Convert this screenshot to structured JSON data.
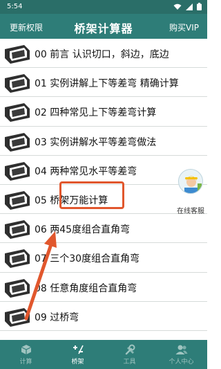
{
  "status_bar": {
    "time": "5:54",
    "icons": [
      "wifi-icon",
      "signal-icon",
      "battery-icon"
    ]
  },
  "app_bar": {
    "left_label": "更新权限",
    "title": "桥架计算器",
    "right_label": "购买VIP"
  },
  "list": {
    "items": [
      {
        "label": "00 前言 认识切口，斜边，底边"
      },
      {
        "label": "01 实例讲解上下等差弯 精确计算"
      },
      {
        "label": "02 四种常见上下等差弯计算"
      },
      {
        "label": "03 实例讲解水平等差弯做法"
      },
      {
        "label": "04 两种常见水平等差弯"
      },
      {
        "label": "05 桥架万能计算"
      },
      {
        "label": "06 两45度组合直角弯"
      },
      {
        "label": "07 三个30度组合直角弯"
      },
      {
        "label": "08 任意角度组合直角弯"
      },
      {
        "label": "09 过桥弯"
      }
    ]
  },
  "support": {
    "label": "在线客服"
  },
  "tabs": [
    {
      "label": "计算",
      "icon": "cube-icon",
      "active": false
    },
    {
      "label": "桥架",
      "icon": "plus-minus-icon",
      "active": true
    },
    {
      "label": "工具",
      "icon": "tools-icon",
      "active": false
    },
    {
      "label": "个人中心",
      "icon": "user-icon",
      "active": false
    }
  ],
  "colors": {
    "primary": "#2e7d78",
    "status_bar": "#2a6e68",
    "highlight": "#e1572d",
    "tab_inactive": "#9fc4c0"
  }
}
